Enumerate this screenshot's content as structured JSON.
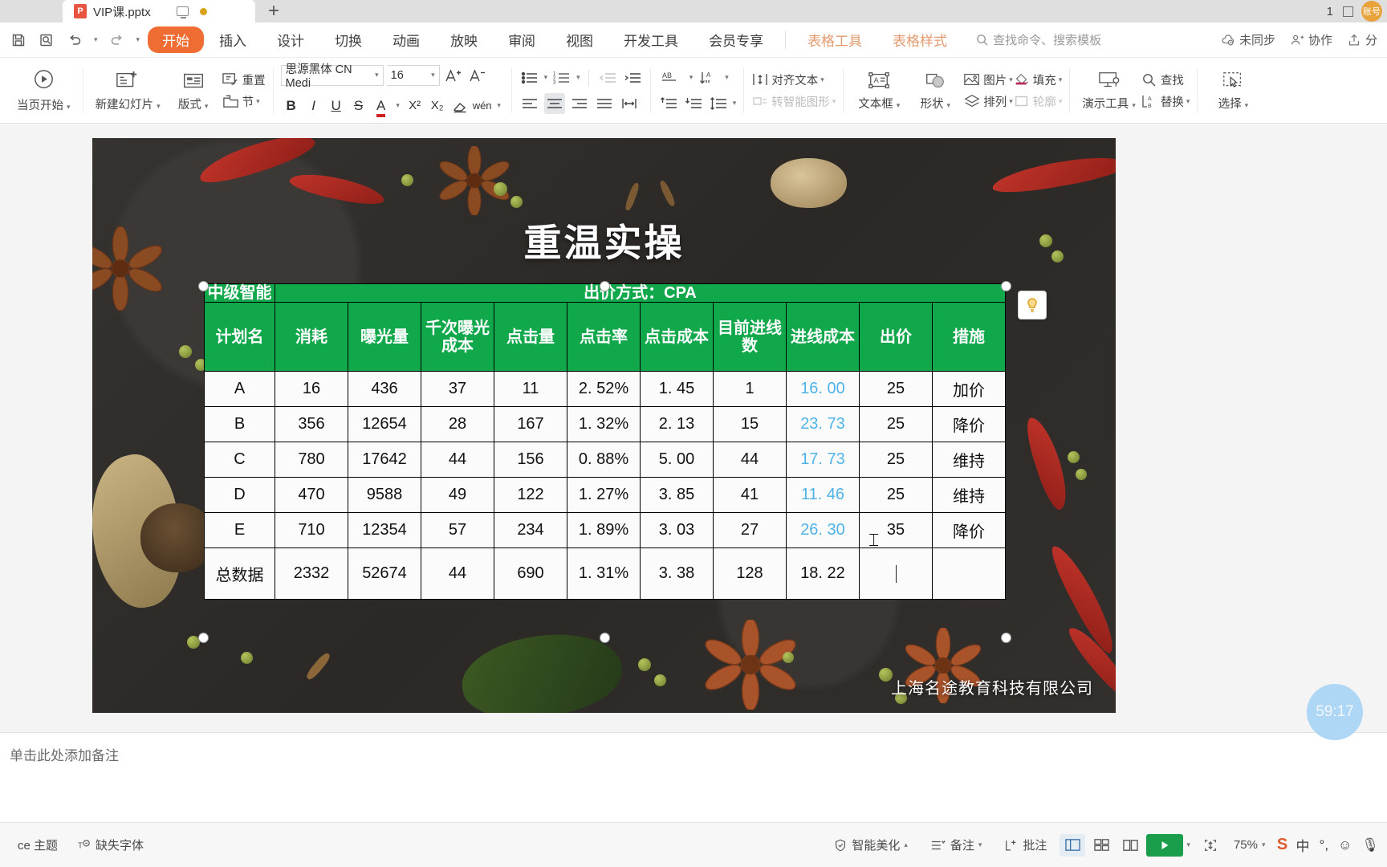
{
  "titlebar": {
    "tab_name": "VIP课.pptx",
    "file_icon": "P",
    "new_tab": "+",
    "window_count": "1",
    "monitor_icon": "monitor-icon",
    "unsaved_dot": "unsaved-dot"
  },
  "menubar": {
    "items": [
      {
        "label": "开始",
        "active": true
      },
      {
        "label": "插入",
        "active": false
      },
      {
        "label": "设计",
        "active": false
      },
      {
        "label": "切换",
        "active": false
      },
      {
        "label": "动画",
        "active": false
      },
      {
        "label": "放映",
        "active": false
      },
      {
        "label": "审阅",
        "active": false
      },
      {
        "label": "视图",
        "active": false
      },
      {
        "label": "开发工具",
        "active": false
      },
      {
        "label": "会员专享",
        "active": false
      }
    ],
    "context_tabs": [
      {
        "label": "表格工具"
      },
      {
        "label": "表格样式"
      }
    ],
    "search_placeholder": "查找命令、搜索模板",
    "right_items": [
      {
        "label": "未同步",
        "icon": "cloud-sync-icon"
      },
      {
        "label": "协作",
        "icon": "collaborate-icon"
      },
      {
        "label": "分",
        "icon": "share-icon"
      }
    ]
  },
  "ribbon": {
    "start_presentation": "当页开始",
    "new_slide": "新建幻灯片",
    "layout": "版式",
    "reset": "重置",
    "section": "节",
    "font_name": "思源黑体 CN Medi",
    "font_size": "16",
    "grow_font": "A+",
    "shrink_font": "A-",
    "bold": "B",
    "italic": "I",
    "underline": "U",
    "strikethrough": "S",
    "font_color": "A",
    "superscript": "X²",
    "subscript": "X₂",
    "clear_format": "clear-format-icon",
    "pinyin": "wén",
    "align_text": "对齐文本",
    "convert_smartart": "转智能图形",
    "textbox": "文本框",
    "shape": "形状",
    "picture": "图片",
    "arrange": "排列",
    "fill": "填充",
    "outline": "轮廓",
    "present_tools": "演示工具",
    "find": "查找",
    "replace": "替换",
    "select": "选择"
  },
  "slide": {
    "title": "重温实操",
    "company": "上海名途教育科技有限公司",
    "timer": "59:17"
  },
  "chart_data": {
    "type": "table",
    "title": "出价方式：CPA",
    "corner_label": "中级智能",
    "columns": [
      "计划名",
      "消耗",
      "曝光量",
      "千次曝光成本",
      "点击量",
      "点击率",
      "点击成本",
      "目前进线数",
      "进线成本",
      "出价",
      "措施"
    ],
    "rows": [
      [
        "A",
        "16",
        "436",
        "37",
        "11",
        "2. 52%",
        "1. 45",
        "1",
        "16. 00",
        "25",
        "加价"
      ],
      [
        "B",
        "356",
        "12654",
        "28",
        "167",
        "1. 32%",
        "2. 13",
        "15",
        "23. 73",
        "25",
        "降价"
      ],
      [
        "C",
        "780",
        "17642",
        "44",
        "156",
        "0. 88%",
        "5. 00",
        "44",
        "17. 73",
        "25",
        "维持"
      ],
      [
        "D",
        "470",
        "9588",
        "49",
        "122",
        "1. 27%",
        "3. 85",
        "41",
        "11. 46",
        "25",
        "维持"
      ],
      [
        "E",
        "710",
        "12354",
        "57",
        "234",
        "1. 89%",
        "3. 03",
        "27",
        "26. 30",
        "35",
        "降价"
      ]
    ],
    "total_row": [
      "总数据",
      "2332",
      "52674",
      "44",
      "690",
      "1. 31%",
      "3. 38",
      "128",
      "18. 22",
      "",
      ""
    ],
    "header_bg": "#11a74b",
    "cell_bg": "#fbfbfb",
    "highlight_color": "#4fb3e8",
    "highlight_column": "进线成本"
  },
  "notes": {
    "placeholder": "单击此处添加备注"
  },
  "statusbar": {
    "theme_label": "ce 主题",
    "missing_font": "缺失字体",
    "beautify": "智能美化",
    "notes": "备注",
    "comments": "批注",
    "zoom": "75%",
    "ime_lang": "中",
    "views": [
      "normal-view-icon",
      "slide-sorter-icon",
      "reading-view-icon"
    ]
  }
}
